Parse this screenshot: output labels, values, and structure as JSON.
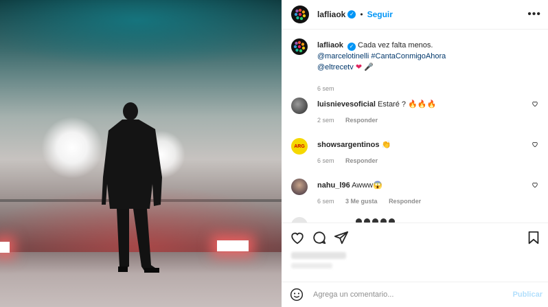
{
  "post": {
    "username": "lafliaok",
    "follow_label": "Seguir",
    "more_label": "•••",
    "caption_text": "Cada vez falta menos.",
    "caption_mention1": "@marcelotinelli",
    "caption_hashtag": "#CantaConmigoAhora",
    "caption_mention2": "@eltrecetv",
    "caption_time": "6 sem"
  },
  "comments": [
    {
      "username": "luisnievesoficial",
      "text": "Estaré ? 🔥🔥🔥",
      "time": "2 sem",
      "likes": "",
      "reply": "Responder"
    },
    {
      "username": "showsargentinos",
      "text": "👏",
      "time": "6 sem",
      "likes": "",
      "reply": "Responder"
    },
    {
      "username": "nahu_l96",
      "text": "Awww😱",
      "time": "6 sem",
      "likes": "3 Me gusta",
      "reply": "Responder"
    }
  ],
  "composer": {
    "placeholder": "Agrega un comentario...",
    "publish_label": "Publicar"
  },
  "colors": {
    "accent": "#0095f6",
    "link": "#00376b"
  }
}
